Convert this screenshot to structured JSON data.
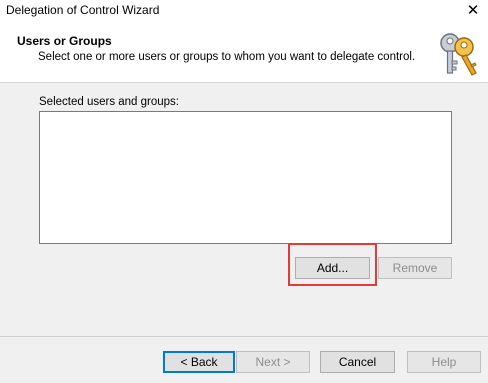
{
  "window": {
    "title": "Delegation of Control Wizard",
    "close_glyph": "✕"
  },
  "header": {
    "title": "Users or Groups",
    "subtitle": "Select one or more users or groups to whom you want to delegate control.",
    "icon": "keys-icon"
  },
  "content": {
    "list_label": "Selected users and groups:",
    "items": []
  },
  "buttons": {
    "add": "Add...",
    "remove": "Remove",
    "back": "< Back",
    "next": "Next >",
    "cancel": "Cancel",
    "help": "Help"
  },
  "colors": {
    "highlight": "#e03c3c",
    "default_button_border": "#0078d7"
  }
}
